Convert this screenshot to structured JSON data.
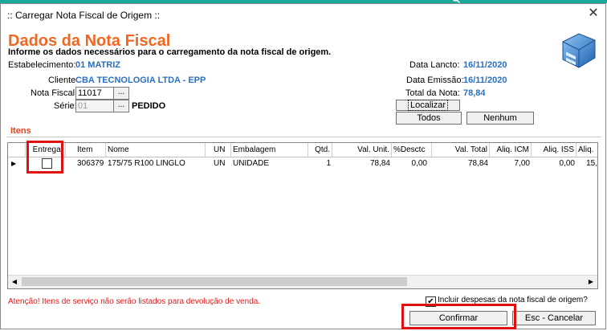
{
  "window": {
    "title": ":: Carregar Nota Fiscal de Origem ::"
  },
  "header": {
    "title": "Dados da Nota Fiscal",
    "subtitle": "Informe os dados necessários para o carregamento da nota fiscal de origem."
  },
  "form": {
    "estabelecimento_label": "Estabelecimento:",
    "estabelecimento_value": "01 MATRIZ",
    "cliente_label": "Cliente",
    "cliente_value": "CBA TECNOLOGIA LTDA - EPP",
    "nota_fiscal_label": "Nota Fiscal:",
    "nota_fiscal_value": "11017",
    "serie_label": "Série:",
    "serie_value": "01",
    "dots_label": "...",
    "pedido_label": "PEDIDO",
    "data_lancto_label": "Data Lancto:",
    "data_lancto_value": "16/11/2020",
    "data_emissao_label": "Data Emissão:",
    "data_emissao_value": "16/11/2020",
    "total_nota_label": "Total da Nota:",
    "total_nota_value": "78,84"
  },
  "buttons": {
    "localizar": "Localizar",
    "todos": "Todos",
    "nenhum": "Nenhum",
    "confirmar": "Confirmar",
    "cancelar": "Esc - Cancelar"
  },
  "itens_label": "Itens",
  "grid": {
    "columns": [
      "Entregar",
      "Item",
      "Nome",
      "UN",
      "Embalagem",
      "Qtd.",
      "Val. Unit.",
      "%Desctc",
      "Val. Total",
      "Aliq. ICM",
      "Aliq. ISS",
      "Aliq."
    ],
    "rows": [
      {
        "entregar": false,
        "item": "306379",
        "nome": "175/75 R100 LINGLO",
        "un": "UN",
        "embalagem": "UNIDADE",
        "qtd": "1",
        "val_unit": "78,84",
        "desc": "0,00",
        "val_total": "78,84",
        "aliq_icm": "7,00",
        "aliq_iss": "0,00",
        "aliq": "15,"
      }
    ]
  },
  "footer": {
    "warning": "Atenção! Itens de serviço não serão listados para devolução de venda.",
    "incluir_despesas": "Incluir despesas da nota fiscal de origem?",
    "incluir_despesas_checked": true
  },
  "colors": {
    "accent": "#f06722",
    "blue_value": "#2a6fc2",
    "warning": "#e21b1b",
    "highlight": "#e01010"
  }
}
